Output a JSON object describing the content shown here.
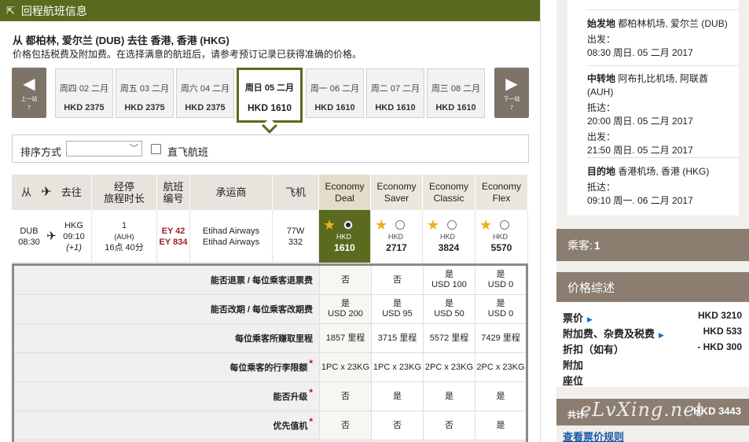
{
  "header": {
    "title": "回程航班信息"
  },
  "route_title": "从 都柏林, 爱尔兰 (DUB) 去往 香港, 香港 (HKG)",
  "price_note": "价格包括税费及附加费。在选择满意的航班后，请参考预订记录已获得准确的价格。",
  "date_strip": {
    "prev": {
      "label": "上一站",
      "count": "7"
    },
    "next": {
      "label": "下一站",
      "count": "7"
    },
    "days": [
      {
        "date": "周四 02 二月",
        "price": "HKD 2375"
      },
      {
        "date": "周五 03 二月",
        "price": "HKD 2375"
      },
      {
        "date": "周六 04 二月",
        "price": "HKD 2375"
      },
      {
        "date": "周日 05 二月",
        "price": "HKD 1610",
        "selected": true
      },
      {
        "date": "周一 06 二月",
        "price": "HKD 1610"
      },
      {
        "date": "周二 07 二月",
        "price": "HKD 1610"
      },
      {
        "date": "周三 08 二月",
        "price": "HKD 1610"
      }
    ]
  },
  "sort": {
    "label": "排序方式",
    "value": "",
    "direct_label": "直飞航班"
  },
  "table": {
    "headers": {
      "from": "从",
      "to": "去往",
      "stops": "经停",
      "duration": "旅程时长",
      "flight_no": "航班",
      "flight_no2": "编号",
      "carrier": "承运商",
      "aircraft": "飞机"
    },
    "fares": [
      {
        "name": "Economy",
        "name2": "Deal"
      },
      {
        "name": "Economy",
        "name2": "Saver"
      },
      {
        "name": "Economy",
        "name2": "Classic"
      },
      {
        "name": "Economy",
        "name2": "Flex"
      }
    ],
    "flight": {
      "from_code": "DUB",
      "from_time": "08:30",
      "to_code": "HKG",
      "to_time": "09:10",
      "to_offset": "(+1)",
      "stops": "1",
      "stop_code": "(AUH)",
      "duration": "16点 40分",
      "flight1": "EY 42",
      "flight2": "EY 834",
      "carrier1": "Etihad Airways",
      "carrier2": "Etihad Airways",
      "aircraft1": "77W",
      "aircraft2": "332",
      "prices": [
        {
          "currency": "HKD",
          "amount": "1610",
          "selected": true
        },
        {
          "currency": "HKD",
          "amount": "2717"
        },
        {
          "currency": "HKD",
          "amount": "3824"
        },
        {
          "currency": "HKD",
          "amount": "5570"
        }
      ]
    },
    "details": [
      {
        "label": "能否退票 / 每位乘客退票费",
        "required": false,
        "values": [
          [
            "否",
            ""
          ],
          [
            "否",
            ""
          ],
          [
            "是",
            "USD 100"
          ],
          [
            "是",
            "USD 0"
          ]
        ]
      },
      {
        "label": "能否改期 / 每位乘客改期费",
        "required": false,
        "values": [
          [
            "是",
            "USD 200"
          ],
          [
            "是",
            "USD 95"
          ],
          [
            "是",
            "USD 50"
          ],
          [
            "是",
            "USD 0"
          ]
        ]
      },
      {
        "label": "每位乘客所赚取里程",
        "required": false,
        "values": [
          [
            "1857 里程",
            ""
          ],
          [
            "3715 里程",
            ""
          ],
          [
            "5572 里程",
            ""
          ],
          [
            "7429 里程",
            ""
          ]
        ]
      },
      {
        "label": "每位乘客的行李限额",
        "required": true,
        "values": [
          [
            "1PC x 23KG",
            ""
          ],
          [
            "1PC x 23KG",
            ""
          ],
          [
            "2PC x 23KG",
            ""
          ],
          [
            "2PC x 23KG",
            ""
          ]
        ]
      },
      {
        "label": "能否升级",
        "required": true,
        "values": [
          [
            "否",
            ""
          ],
          [
            "是",
            ""
          ],
          [
            "是",
            ""
          ],
          [
            "是",
            ""
          ]
        ]
      },
      {
        "label": "优先值机",
        "required": true,
        "values": [
          [
            "否",
            ""
          ],
          [
            "否",
            ""
          ],
          [
            "否",
            ""
          ],
          [
            "是",
            ""
          ]
        ]
      }
    ]
  },
  "itinerary": {
    "departure": {
      "title": "始发地",
      "place": "都柏林机场, 爱尔兰 (DUB)",
      "dep_label": "出发：",
      "dep_time": "08:30 周日. 05 二月 2017"
    },
    "transit": {
      "title": "中转地",
      "place": "阿布扎比机场, 阿联酋",
      "place2": "(AUH)",
      "arr_label": "抵达：",
      "arr_time": "20:00 周日. 05 二月 2017",
      "dep_label": "出发：",
      "dep_time": "21:50 周日. 05 二月 2017"
    },
    "destination": {
      "title": "目的地",
      "place": "香港机场, 香港 (HKG)",
      "arr_label": "抵达：",
      "arr_time": "09:10 周一. 06 二月 2017"
    }
  },
  "passengers": {
    "label": "乘客:",
    "count": "1"
  },
  "price_summary": {
    "title": "价格综述",
    "rows": [
      {
        "label": "票价",
        "amount": "HKD 3210",
        "has_link": true
      },
      {
        "label": "附加费、杂费及税费",
        "amount": "HKD 533",
        "has_link": true
      },
      {
        "label": "折扣（如有）",
        "amount": "- HKD 300",
        "has_link": false
      },
      {
        "label": "附加",
        "amount": "",
        "has_link": false
      },
      {
        "label": "座位",
        "amount": "",
        "has_link": false
      }
    ],
    "total_label": "共计:",
    "total_amount": "HKD 3443",
    "watermark": "eLvXing.net",
    "rules_link": "查看票价规则"
  },
  "colors": {
    "accent_olive": "#5a6a1e",
    "panel_brown": "#8b7e71",
    "star": "#e8b21a",
    "required": "#dd0000"
  }
}
